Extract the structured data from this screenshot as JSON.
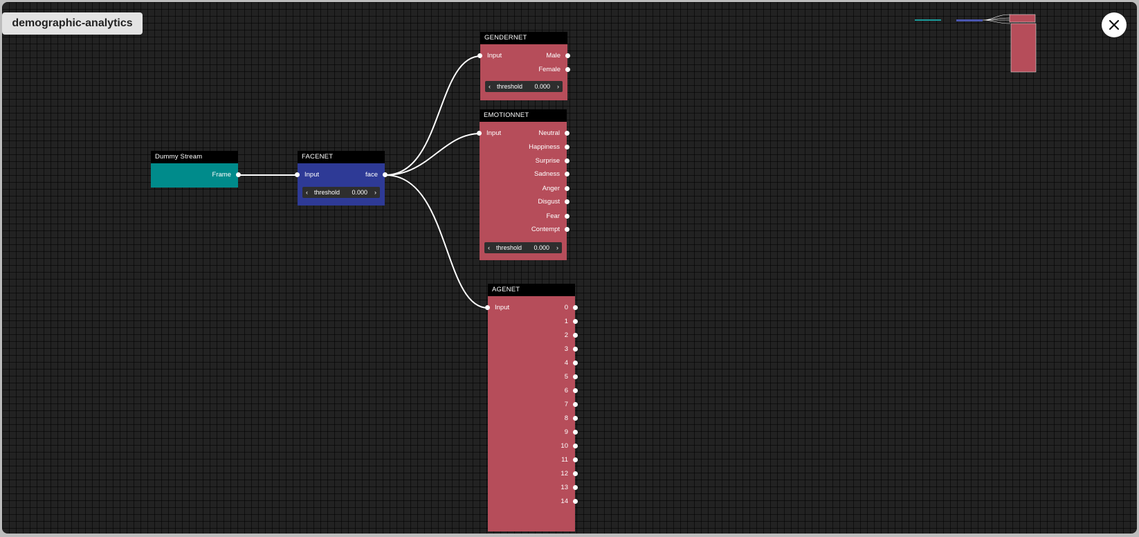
{
  "graph": {
    "title": "demographic-analytics"
  },
  "colors": {
    "stream": "#008b8b",
    "facenet": "#2e3a96",
    "net": "#b64d5a",
    "header": "#000000",
    "wire": "#ffffff"
  },
  "icons": {
    "close": "close-icon",
    "prev": "chevron-left-icon",
    "next": "chevron-right-icon"
  },
  "nodes": {
    "dummy": {
      "title": "Dummy Stream",
      "output": "Frame"
    },
    "facenet": {
      "title": "FACENET",
      "input": "Input",
      "output": "face",
      "param_name": "threshold",
      "param_value": "0.000"
    },
    "gendernet": {
      "title": "GENDERNET",
      "input": "Input",
      "outputs": [
        "Male",
        "Female"
      ],
      "param_name": "threshold",
      "param_value": "0.000"
    },
    "emotionnet": {
      "title": "EMOTIONNET",
      "input": "Input",
      "outputs": [
        "Neutral",
        "Happiness",
        "Surprise",
        "Sadness",
        "Anger",
        "Disgust",
        "Fear",
        "Contempt"
      ],
      "param_name": "threshold",
      "param_value": "0.000"
    },
    "agenet": {
      "title": "AGENET",
      "input": "Input",
      "outputs": [
        "0",
        "1",
        "2",
        "3",
        "4",
        "5",
        "6",
        "7",
        "8",
        "9",
        "10",
        "11",
        "12",
        "13",
        "14"
      ]
    }
  }
}
